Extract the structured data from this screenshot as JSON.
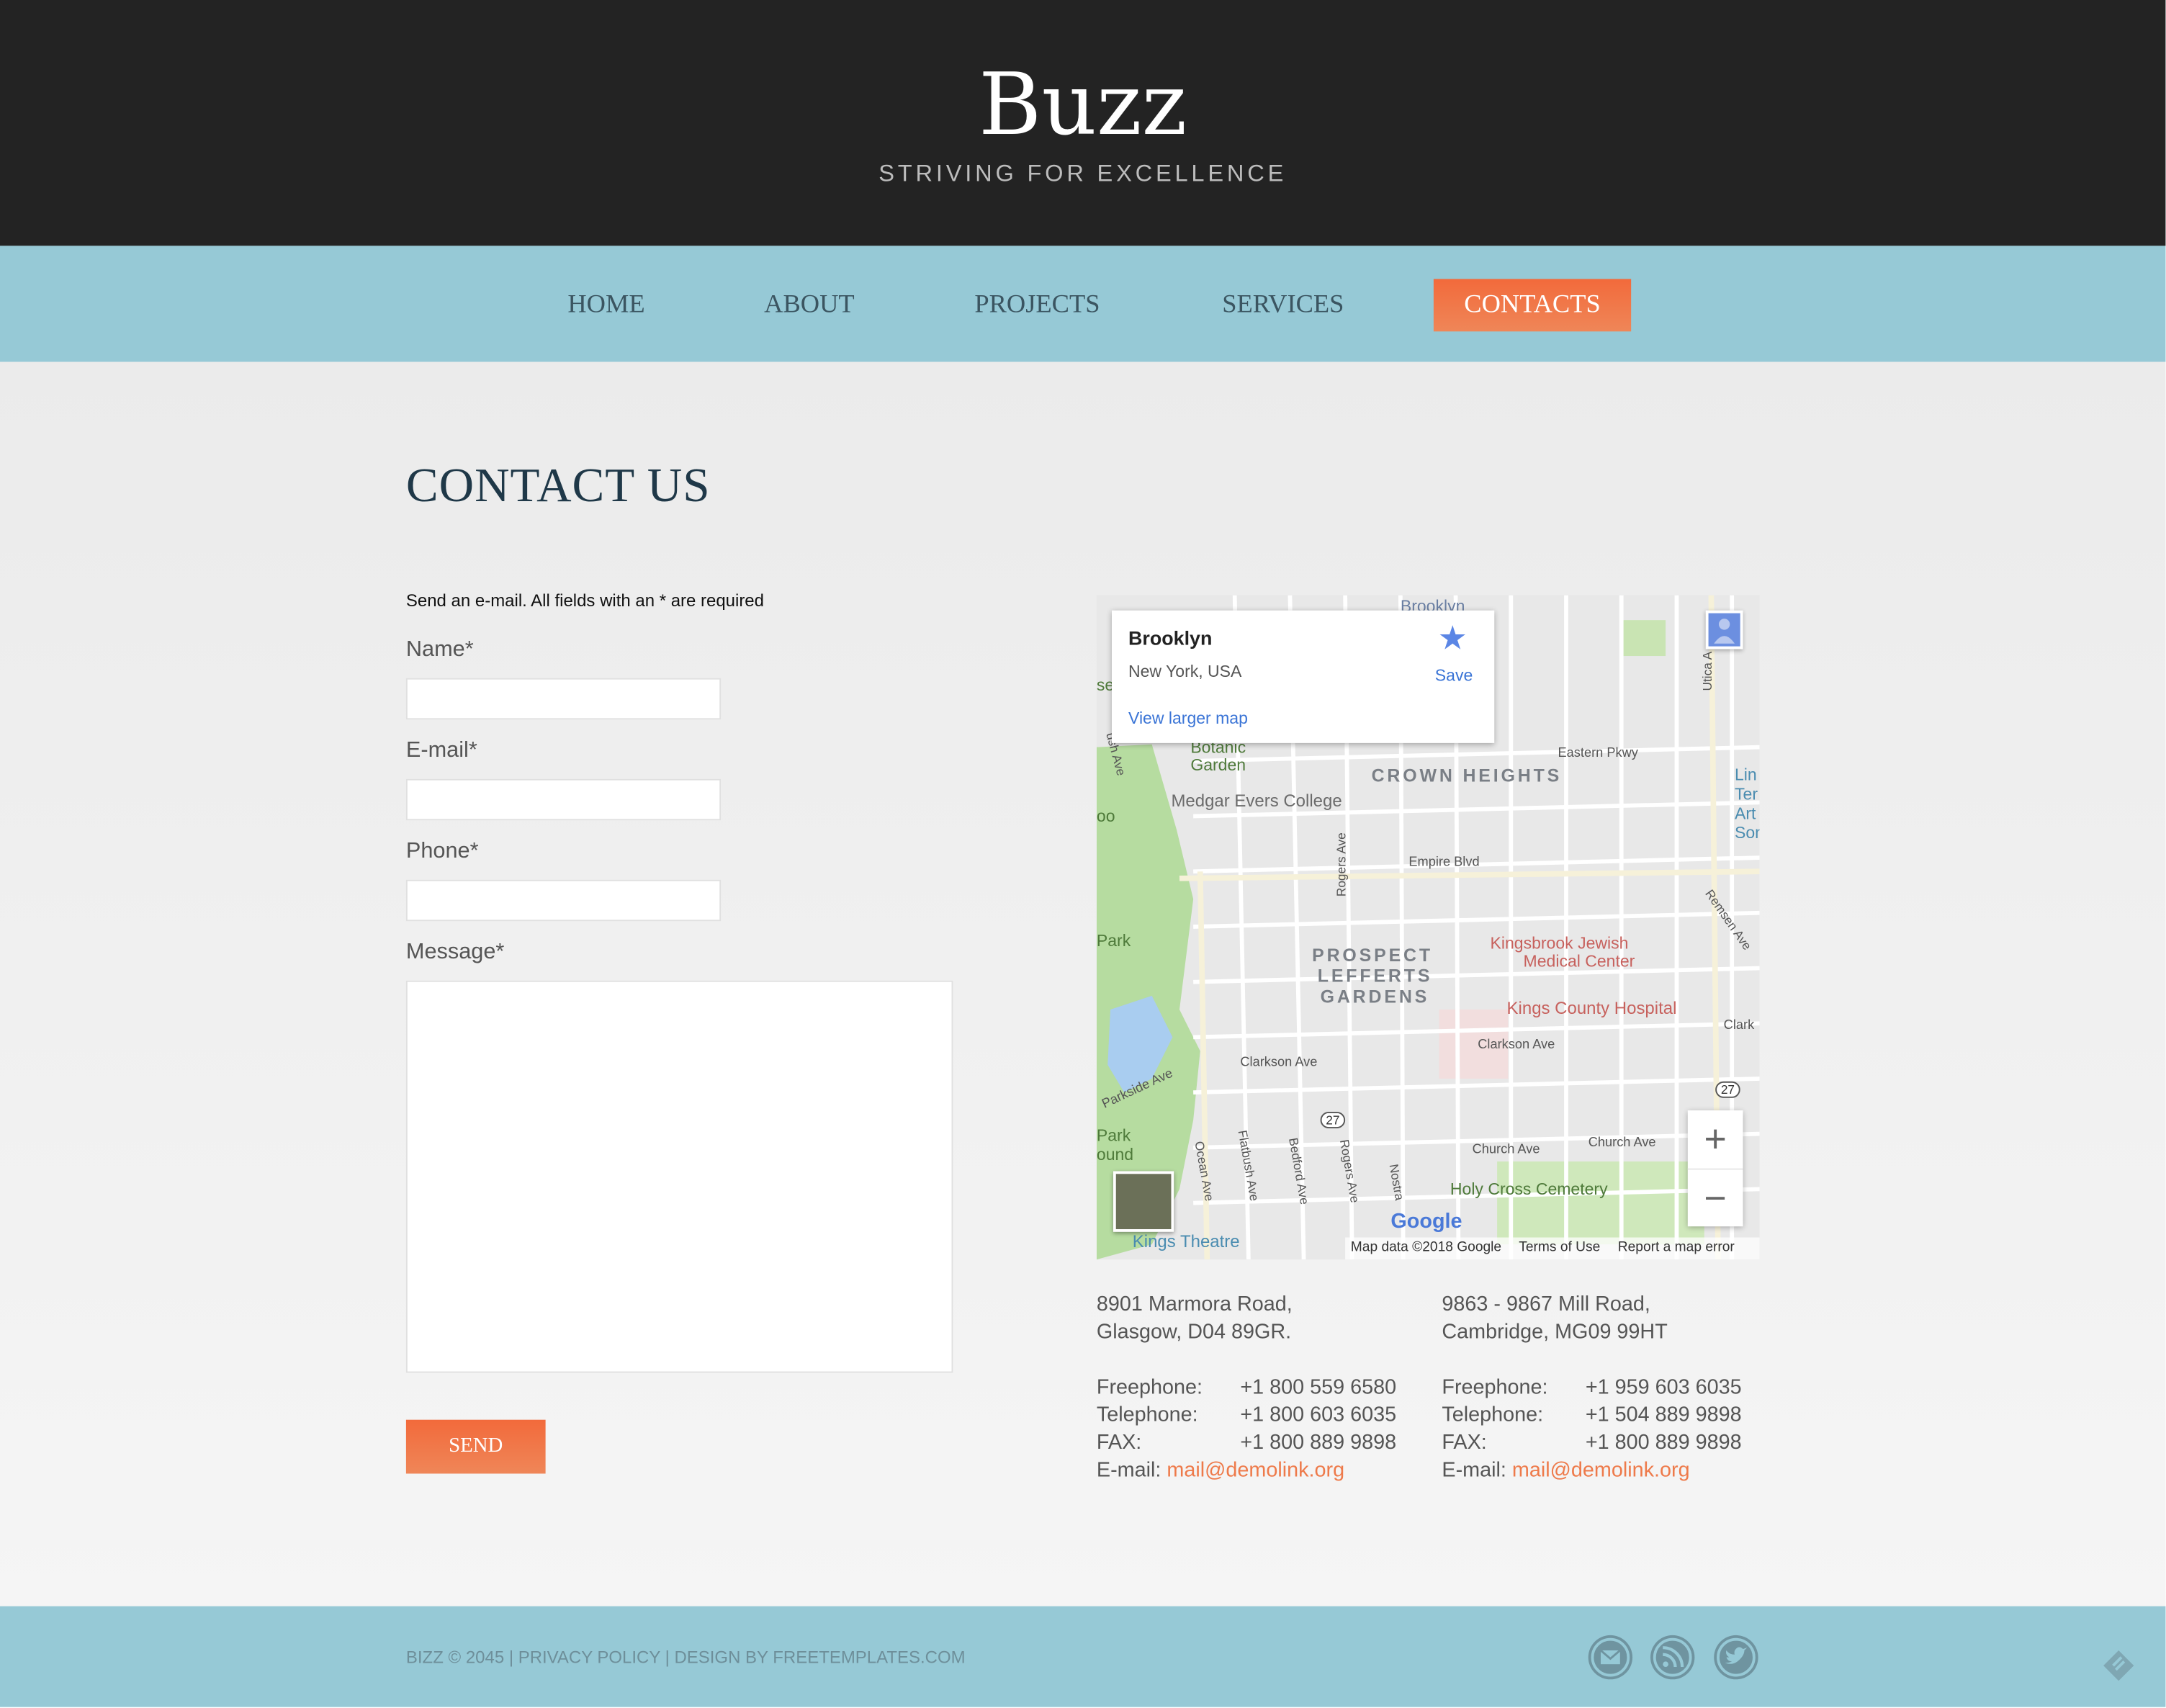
{
  "site": {
    "logo": "Buzz",
    "tagline": "STRIVING FOR EXCELLENCE"
  },
  "nav": {
    "items": [
      {
        "label": "HOME"
      },
      {
        "label": "ABOUT"
      },
      {
        "label": "PROJECTS"
      },
      {
        "label": "SERVICES"
      },
      {
        "label": "CONTACTS"
      }
    ],
    "active": "CONTACTS"
  },
  "main": {
    "title": "CONTACT US",
    "intro": "Send an e-mail. All fields with an * are required"
  },
  "form": {
    "name_label": "Name*",
    "email_label": "E-mail*",
    "phone_label": "Phone*",
    "message_label": "Message*",
    "name_value": "",
    "email_value": "",
    "phone_value": "",
    "message_value": "",
    "send_label": "SEND"
  },
  "map": {
    "place_title": "Brooklyn",
    "place_subtitle": "New York, USA",
    "save_label": "Save",
    "larger_map": "View larger map",
    "zoom_in": "+",
    "zoom_out": "−",
    "google": "Google",
    "attribution": {
      "data": "Map data ©2018 Google",
      "terms": "Terms of Use",
      "report": "Report a map error"
    },
    "labels": {
      "brooklyn_top": "Brooklyn",
      "botanic": "Botanic",
      "garden": "Garden",
      "medgar": "Medgar Evers College",
      "crown": "CROWN HEIGHTS",
      "eastern": "Eastern Pkwy",
      "empire": "Empire Blvd",
      "prospect1": "PROSPECT",
      "prospect2": "LEFFERTS",
      "prospect3": "GARDENS",
      "kingsbrook1": "Kingsbrook Jewish",
      "kingsbrook2": "Medical Center",
      "kings_county": "Kings County Hospital",
      "clarkson1": "Clarkson Ave",
      "clarkson2": "Clarkson Ave",
      "clarkson3": "Clark",
      "parkside": "Parkside Ave",
      "church1": "Church Ave",
      "church2": "Church Ave",
      "holy_cross": "Holy Cross Cemetery",
      "kings_theatre": "Kings Theatre",
      "park": "Park",
      "park2": "Park",
      "ound": "ound",
      "rogers1": "Rogers Ave",
      "rogers2": "Rogers Ave",
      "ocean": "Ocean Ave",
      "flatbush": "Flatbush Ave",
      "bedford": "Bedford Ave",
      "nostrand": "Nostra",
      "remsen": "Remsen Ave",
      "utica": "Utica A",
      "lin": "Lin",
      "ter": "Ter",
      "art": "Art",
      "som": "Som",
      "se": "se",
      "oo": "oo",
      "ush": "ush Ave",
      "route27a": "27",
      "route27b": "27"
    }
  },
  "offices": [
    {
      "addr1": "8901 Marmora Road,",
      "addr2": "Glasgow, D04 89GR.",
      "freephone_label": "Freephone:",
      "freephone": "+1 800 559 6580",
      "telephone_label": "Telephone:",
      "telephone": "+1 800 603 6035",
      "fax_label": "FAX:",
      "fax": "+1 800 889 9898",
      "email_label": "E-mail:",
      "email": "mail@demolink.org"
    },
    {
      "addr1": "9863 - 9867 Mill Road,",
      "addr2": "Cambridge, MG09 99HT",
      "freephone_label": "Freephone:",
      "freephone": "+1 959 603 6035",
      "telephone_label": "Telephone:",
      "telephone": "+1 504 889 9898",
      "fax_label": "FAX:",
      "fax": "+1 800 889 9898",
      "email_label": "E-mail:",
      "email": "mail@demolink.org"
    }
  ],
  "footer": {
    "copyright": "BIZZ © 2045 | PRIVACY POLICY | DESIGN BY FREETEMPLATES.COM",
    "icons": [
      "mail-icon",
      "rss-icon",
      "twitter-icon"
    ]
  },
  "colors": {
    "header_bg": "#232323",
    "nav_bg": "#96c9d6",
    "accent": "#f26a3b",
    "title": "#1f3848"
  }
}
